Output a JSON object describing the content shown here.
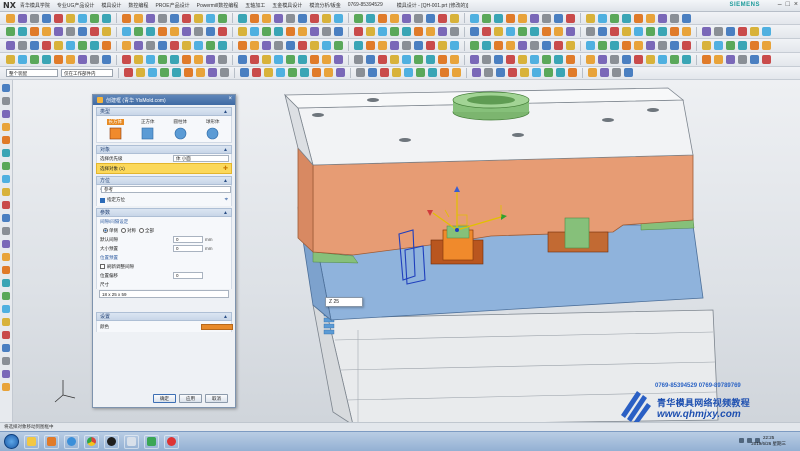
{
  "window": {
    "app_logo": "NX",
    "menu_items": [
      "青华模具学院",
      "专业UG产品设计",
      "模具设计",
      "数控编程",
      "PROE产品设计",
      "Powermill数控编程",
      "五轴加工",
      "五金模具设计",
      "模流分析/钣金",
      "0769-85394529",
      "微信",
      "QQ"
    ],
    "file_name": "模具设计 - [QH-001.prt (修改的)]",
    "brand": "SIEMENS",
    "controls": [
      "–",
      "□",
      "×"
    ]
  },
  "toolbar": {
    "filter_value": "整个装配",
    "select_scope": "仅在工作部件内"
  },
  "dialog": {
    "title": "创建框 (青华 YlsMold.com)",
    "close": "×",
    "type_section": "类型",
    "types": [
      {
        "label": "长方体",
        "selected": true
      },
      {
        "label": "正方体",
        "selected": false
      },
      {
        "label": "圆柱体",
        "selected": false
      },
      {
        "label": "球形体",
        "selected": false
      }
    ],
    "object_section": "对象",
    "selection_priority_label": "选择优先级",
    "selection_priority_value": "体 小面",
    "select_object_label": "选择对象 (1)",
    "orient_section": "方位",
    "csys_label": "参考",
    "csys_value": "",
    "specify_orient_label": "指定方位",
    "params_section": "参数",
    "clearance_mode_label": "间隙/间隔设定",
    "radio_options": [
      "单侧",
      "对称",
      "全部"
    ],
    "clearance_label": "默认间隙",
    "clearance_value": "0",
    "clearance_unit": "mm",
    "size_label": "大小预置",
    "size_value": "0",
    "size_unit": "mm",
    "position_label": "位置预置",
    "checkbox_label": "刷新调整间隙",
    "offset_label": "位置偏移",
    "offset_value": "0",
    "dim_label": "尺寸",
    "dim_value": "18 x 25 x 59",
    "color_section": "设置",
    "color_label": "颜色",
    "color_value": "#e88a2a",
    "buttons": {
      "ok": "确定",
      "apply": "应用",
      "cancel": "取消"
    }
  },
  "viewport": {
    "dimension_input": "Z 25",
    "colors": {
      "plate_top": "#f2f3f5",
      "cavity_plate": "#e79c74",
      "core_plate": "#8fb3dc",
      "green": "#86c07a",
      "orange_box": "#e8874a",
      "bottom_frame": "#eceeef"
    }
  },
  "status_bar": "将选择对象移动到图框中",
  "watermark": {
    "phone": "0769-85394529   0769-89789769",
    "name": "青华模具网络视频教程",
    "url": "www.qhmjxy.com"
  },
  "taskbar": {
    "time": "22:25",
    "date": "2019/6/26 星期三"
  }
}
